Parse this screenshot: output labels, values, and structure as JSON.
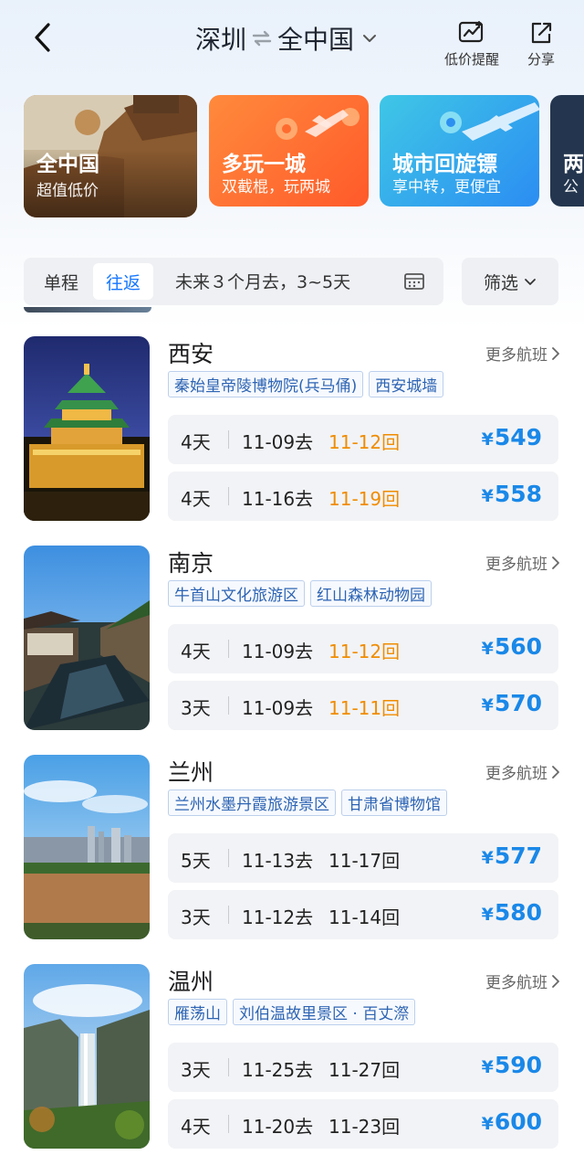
{
  "header": {
    "from": "深圳",
    "to": "全中国",
    "price_alert_label": "低价提醒",
    "share_label": "分享"
  },
  "promos": [
    {
      "title": "全中国",
      "subtitle": "超值低价"
    },
    {
      "title": "多玩一城",
      "subtitle": "双截棍，玩两城"
    },
    {
      "title": "城市回旋镖",
      "subtitle": "享中转，更便宜"
    },
    {
      "title": "两",
      "subtitle": "公"
    }
  ],
  "filter": {
    "one_way": "单程",
    "round_trip": "往返",
    "range": "未来３个月去，3~5天",
    "filter_label": "筛选"
  },
  "more_label": "更多航班",
  "currency": "¥",
  "colors": {
    "accent": "#1677ff",
    "price": "#1a88e8",
    "return_highlight": "#f08c00"
  },
  "cities": [
    {
      "name": "西安",
      "tags": [
        "秦始皇帝陵博物院(兵马俑)",
        "西安城墙"
      ],
      "flights": [
        {
          "days": "4天",
          "go": "11-09去",
          "back": "11-12回",
          "back_highlight": true,
          "price": "549"
        },
        {
          "days": "4天",
          "go": "11-16去",
          "back": "11-19回",
          "back_highlight": true,
          "price": "558"
        }
      ]
    },
    {
      "name": "南京",
      "tags": [
        "牛首山文化旅游区",
        "红山森林动物园"
      ],
      "flights": [
        {
          "days": "4天",
          "go": "11-09去",
          "back": "11-12回",
          "back_highlight": true,
          "price": "560"
        },
        {
          "days": "3天",
          "go": "11-09去",
          "back": "11-11回",
          "back_highlight": true,
          "price": "570"
        }
      ]
    },
    {
      "name": "兰州",
      "tags": [
        "兰州水墨丹霞旅游景区",
        "甘肃省博物馆"
      ],
      "flights": [
        {
          "days": "5天",
          "go": "11-13去",
          "back": "11-17回",
          "back_highlight": false,
          "price": "577"
        },
        {
          "days": "3天",
          "go": "11-12去",
          "back": "11-14回",
          "back_highlight": false,
          "price": "580"
        }
      ]
    },
    {
      "name": "温州",
      "tags": [
        "雁荡山",
        "刘伯温故里景区 · 百丈漈"
      ],
      "flights": [
        {
          "days": "3天",
          "go": "11-25去",
          "back": "11-27回",
          "back_highlight": false,
          "price": "590"
        },
        {
          "days": "4天",
          "go": "11-20去",
          "back": "11-23回",
          "back_highlight": false,
          "price": "600"
        }
      ]
    }
  ]
}
